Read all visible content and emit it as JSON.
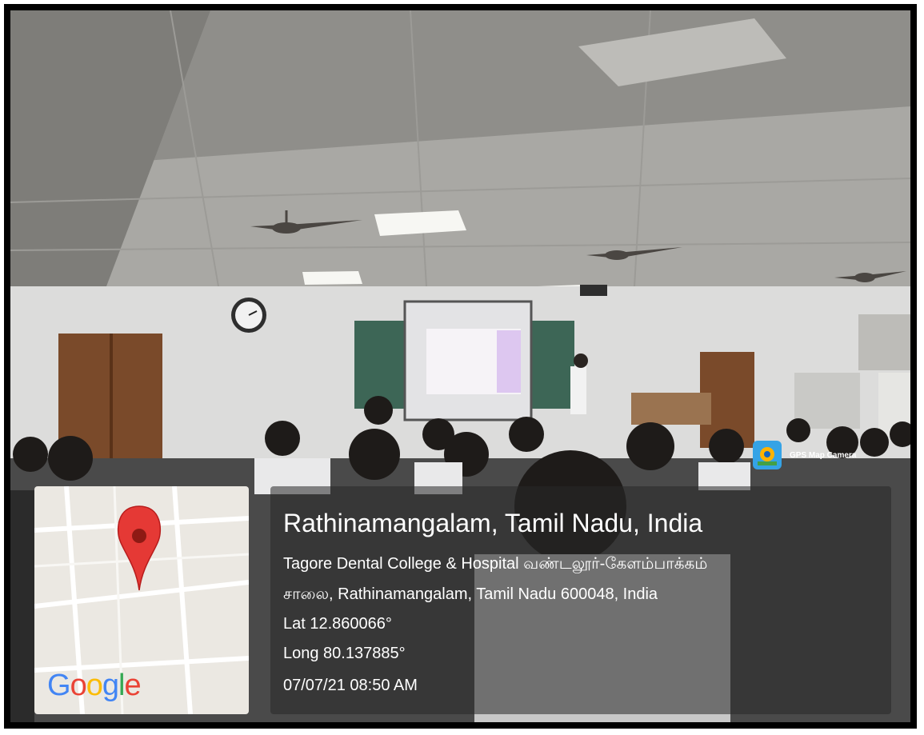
{
  "location": {
    "title": "Rathinamangalam, Tamil Nadu, India",
    "address_line1": "Tagore Dental College & Hospital வண்டலூர்-கேளம்பாக்கம்",
    "address_line2": "சாலை, Rathinamangalam, Tamil Nadu 600048, India",
    "latitude": "Lat 12.860066°",
    "longitude": "Long 80.137885°",
    "datetime": "07/07/21 08:50 AM"
  },
  "badge": {
    "label": "GPS Map Camera",
    "icon": "gps-map-camera-icon"
  },
  "map": {
    "logo_text": "Google",
    "pin_icon": "map-pin-icon",
    "pin_color": "#e53935"
  },
  "colors": {
    "google_blue": "#4285f4",
    "google_red": "#ea4335",
    "google_yellow": "#fbbc05",
    "google_green": "#34a853"
  }
}
